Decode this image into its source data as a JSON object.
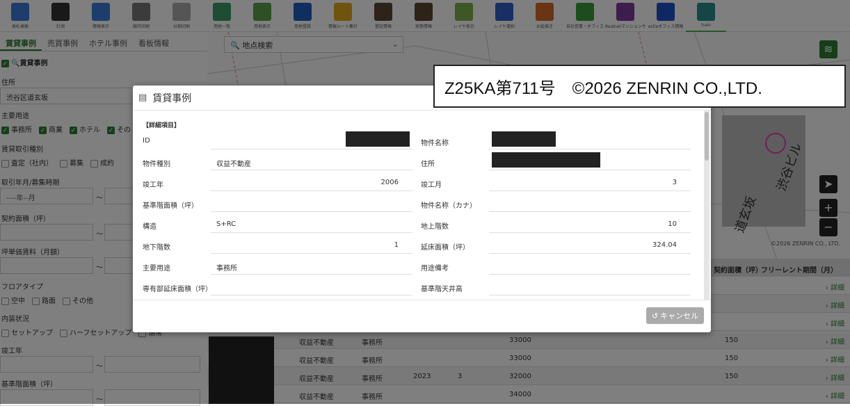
{
  "toolbar": [
    {
      "label": "表札検索",
      "icon": "magnifier-icon",
      "color": "#3b7dd8"
    },
    {
      "label": "計測",
      "icon": "ruler-icon",
      "color": "#333"
    },
    {
      "label": "情報表示",
      "icon": "info-hand-icon",
      "color": "#3b7dd8"
    },
    {
      "label": "縮尺印刷",
      "icon": "printer-icon",
      "color": "#777"
    },
    {
      "label": "分割印刷",
      "icon": "grid-print-icon",
      "color": "#aaa"
    },
    {
      "label": "用地一覧",
      "icon": "checklist-icon",
      "color": "#3a9a6a"
    },
    {
      "label": "用地表示",
      "icon": "layers-icon",
      "color": "#5aa04a"
    },
    {
      "label": "用地登録",
      "icon": "pentagon-icon",
      "color": "#1d5fbf"
    },
    {
      "label": "情報ルート集計",
      "icon": "coin-icon",
      "color": "#e0a81c"
    },
    {
      "label": "登記情報",
      "icon": "ledger-icon",
      "color": "#5a4632"
    },
    {
      "label": "実勢情報",
      "icon": "ledger2-icon",
      "color": "#5a4632"
    },
    {
      "label": "レイヤ表示",
      "icon": "layer-icon",
      "color": "#7bb04a"
    },
    {
      "label": "レイヤ選択",
      "icon": "list-icon",
      "color": "#2f5fc8"
    },
    {
      "label": "お絵描き",
      "icon": "shapes-icon",
      "color": "#d26a2a"
    },
    {
      "label": "自社営業・オフィス",
      "icon": "pin-green-icon",
      "color": "#3a9a3a"
    },
    {
      "label": "Realnetマンションサマリ",
      "icon": "crosshair-icon",
      "color": "#7a3a9a"
    },
    {
      "label": "estieオフィス情報",
      "icon": "stack-icon",
      "color": "#1e50c8"
    },
    {
      "label": "train",
      "icon": "train-icon",
      "color": "#2a8a8a"
    }
  ],
  "left_tabs": [
    "賃貸事例",
    "売買事例",
    "ホテル事例",
    "看板情報"
  ],
  "filters": {
    "header": "賃貸事例",
    "address_label": "住所",
    "address_value": "渋谷区道玄坂",
    "use_label": "主要用途",
    "uses": [
      "事務所",
      "商業",
      "ホテル",
      "その"
    ],
    "type_label": "賃貸取引種別",
    "types": [
      "査定（社内）",
      "募集",
      "成約"
    ],
    "period_label": "取引年月/募集時期",
    "period_placeholder": "----年--月",
    "tilde": "～",
    "area_label": "契約面積（坪）",
    "unit_label": "坪単価賃料（月額）",
    "floor_label": "フロアタイプ",
    "floor_types": [
      "空中",
      "路面",
      "その他"
    ],
    "interior_label": "内装状況",
    "interior": [
      "セットアップ",
      "ハーフセットアップ",
      "通常"
    ],
    "built_label": "竣工年",
    "base_area_label": "基準階面積（坪）"
  },
  "map": {
    "search_placeholder": "地点検索",
    "copyright": "©2026 ZENRIN CO., LTD."
  },
  "copy_notice": "Z25KA第711号　©2026 ZENRIN CO.,LTD.",
  "modal": {
    "title": "賃貸事例",
    "section": "【詳細項目】",
    "fields": [
      {
        "l": "ID",
        "v": "",
        "redact": true
      },
      {
        "l": "物件名称",
        "v": "",
        "redact": true
      },
      {
        "l": "物件種別",
        "v": "収益不動産"
      },
      {
        "l": "住所",
        "v": "",
        "redact": true
      },
      {
        "l": "竣工年",
        "v": "2006",
        "right": true
      },
      {
        "l": "竣工月",
        "v": "3",
        "right": true
      },
      {
        "l": "基準階面積（坪）",
        "v": ""
      },
      {
        "l": "物件名称（カナ）",
        "v": ""
      },
      {
        "l": "構造",
        "v": "S+RC"
      },
      {
        "l": "地上階数",
        "v": "10",
        "right": true
      },
      {
        "l": "地下階数",
        "v": "1",
        "right": true
      },
      {
        "l": "延床面積（坪）",
        "v": "324.04",
        "right": true
      },
      {
        "l": "主要用途",
        "v": "事務所"
      },
      {
        "l": "用途備考",
        "v": ""
      },
      {
        "l": "専有部延床面積（坪）",
        "v": ""
      },
      {
        "l": "基準階天井高",
        "v": ""
      }
    ],
    "cancel": "キャンセル"
  },
  "grid": {
    "headers": [
      "契約面積（坪）",
      "フリーレント期間（月）"
    ],
    "detail": "詳細",
    "rows": [
      {
        "type": "",
        "use": "",
        "year": "",
        "month": "",
        "price": "",
        "area": ""
      },
      {
        "type": "",
        "use": "",
        "year": "",
        "month": "",
        "price": "",
        "area": ""
      },
      {
        "type": "",
        "use": "",
        "year": "",
        "month": "",
        "price": "",
        "area": ""
      },
      {
        "type": "収益不動産",
        "use": "事務所",
        "year": "",
        "month": "",
        "price": "33000",
        "area": "150"
      },
      {
        "type": "収益不動産",
        "use": "事務所",
        "year": "",
        "month": "",
        "price": "33000",
        "area": "150"
      },
      {
        "type": "収益不動産",
        "use": "事務所",
        "year": "2023",
        "month": "3",
        "price": "32000",
        "area": "150"
      },
      {
        "type": "収益不動産",
        "use": "事務所",
        "year": "",
        "month": "",
        "price": "34000",
        "area": ""
      }
    ]
  }
}
